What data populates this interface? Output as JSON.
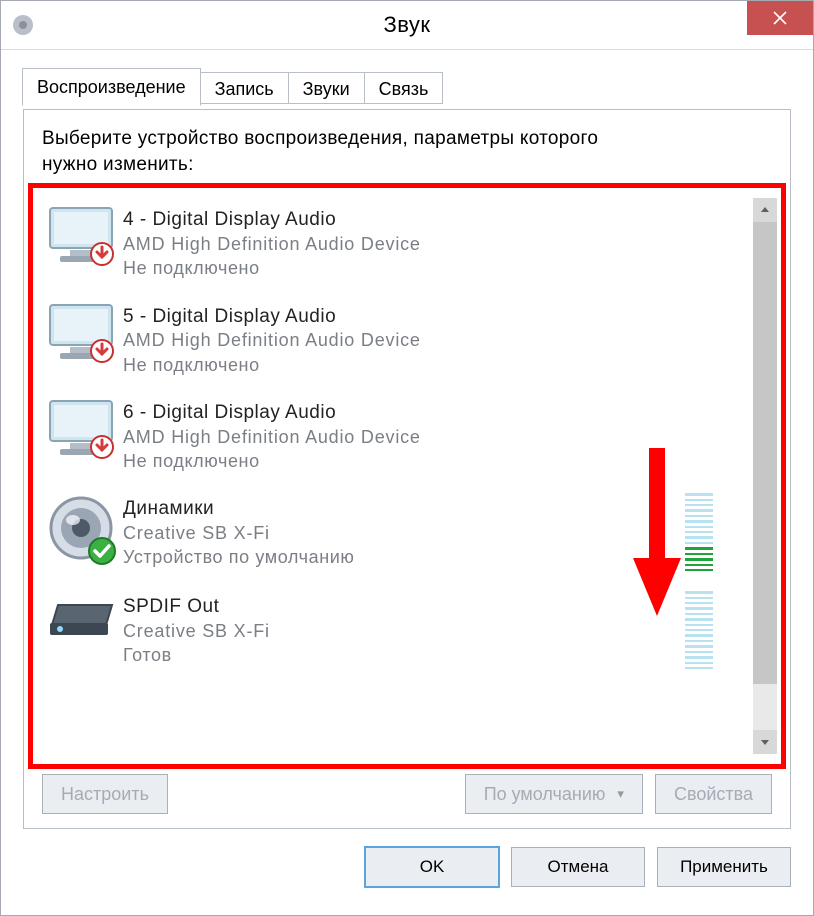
{
  "window": {
    "title": "Звук"
  },
  "tabs": [
    {
      "label": "Воспроизведение",
      "active": true
    },
    {
      "label": "Запись"
    },
    {
      "label": "Звуки"
    },
    {
      "label": "Связь"
    }
  ],
  "instruction_line1": "Выберите устройство воспроизведения, параметры которого",
  "instruction_line2": "нужно изменить:",
  "devices": [
    {
      "title": "4 - Digital Display Audio",
      "sub": "AMD High Definition Audio Device",
      "status": "Не подключено",
      "icon": "monitor",
      "badge": "disconnected"
    },
    {
      "title": "5 - Digital Display Audio",
      "sub": "AMD High Definition Audio Device",
      "status": "Не подключено",
      "icon": "monitor",
      "badge": "disconnected"
    },
    {
      "title": "6 - Digital Display Audio",
      "sub": "AMD High Definition Audio Device",
      "status": "Не подключено",
      "icon": "monitor",
      "badge": "disconnected"
    },
    {
      "title": "Динамики",
      "sub": "Creative SB X-Fi",
      "status": "Устройство по умолчанию",
      "icon": "speaker",
      "badge": "default",
      "meter": true,
      "level": 5
    },
    {
      "title": "SPDIF Out",
      "sub": "Creative SB X-Fi",
      "status": "Готов",
      "icon": "device",
      "meter": true,
      "level": 0
    }
  ],
  "buttons": {
    "configure": "Настроить",
    "set_default": "По умолчанию",
    "properties": "Свойства",
    "ok": "OK",
    "cancel": "Отмена",
    "apply": "Применить"
  }
}
